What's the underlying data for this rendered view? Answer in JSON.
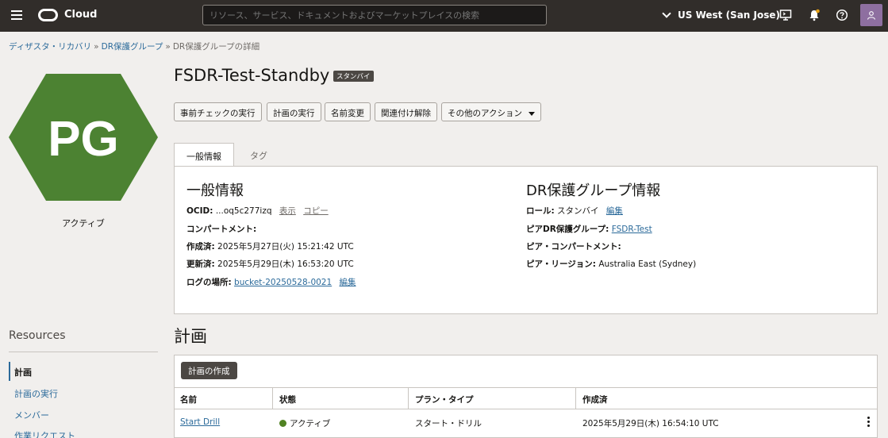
{
  "topbar": {
    "logo_text": "Cloud",
    "search_placeholder": "リソース、サービス、ドキュメントおよびマーケットプレイスの検索",
    "region": "US West (San Jose)"
  },
  "breadcrumb": {
    "items": [
      "ディザスタ・リカバリ",
      "DR保護グループ",
      "DR保護グループの詳細"
    ]
  },
  "entity": {
    "initials": "PG",
    "status": "アクティブ",
    "hex_color": "#4c8232",
    "title": "FSDR-Test-Standby",
    "badge": "スタンバイ"
  },
  "actions": [
    "事前チェックの実行",
    "計画の実行",
    "名前変更",
    "関連付け解除",
    "その他のアクション"
  ],
  "tabs": [
    "一般情報",
    "タグ"
  ],
  "general": {
    "title": "一般情報",
    "ocid_label": "OCID:",
    "ocid_value": "...oq5c277izq",
    "show_link": "表示",
    "copy_link": "コピー",
    "compartment_label": "コンパートメント:",
    "created_label": "作成済:",
    "created_value": "2025年5月27日(火) 15:21:42 UTC",
    "updated_label": "更新済:",
    "updated_value": "2025年5月29日(木) 16:53:20 UTC",
    "log_label": "ログの場所:",
    "log_value": "bucket-20250528-0021",
    "edit_link": "編集"
  },
  "dr_info": {
    "title": "DR保護グループ情報",
    "role_label": "ロール:",
    "role_value": "スタンバイ",
    "edit_link": "編集",
    "peer_label": "ピアDR保護グループ:",
    "peer_value": "FSDR-Test",
    "peer_compartment_label": "ピア・コンパートメント:",
    "peer_region_label": "ピア・リージョン:",
    "peer_region_value": "Australia East (Sydney)"
  },
  "resources": {
    "title": "Resources",
    "items": [
      "計画",
      "計画の実行",
      "メンバー",
      "作業リクエスト"
    ]
  },
  "plans": {
    "title": "計画",
    "create_button": "計画の作成",
    "columns": [
      "名前",
      "状態",
      "プラン・タイプ",
      "作成済"
    ],
    "rows": [
      {
        "name": "Start Drill",
        "state": "アクティブ",
        "type": "スタート・ドリル",
        "created": "2025年5月29日(木) 16:54:10 UTC"
      }
    ]
  },
  "colors": {
    "topbar": "#312d2a",
    "link": "#2b6a9a",
    "active_dot": "#508223",
    "hex": "#4c8232"
  }
}
